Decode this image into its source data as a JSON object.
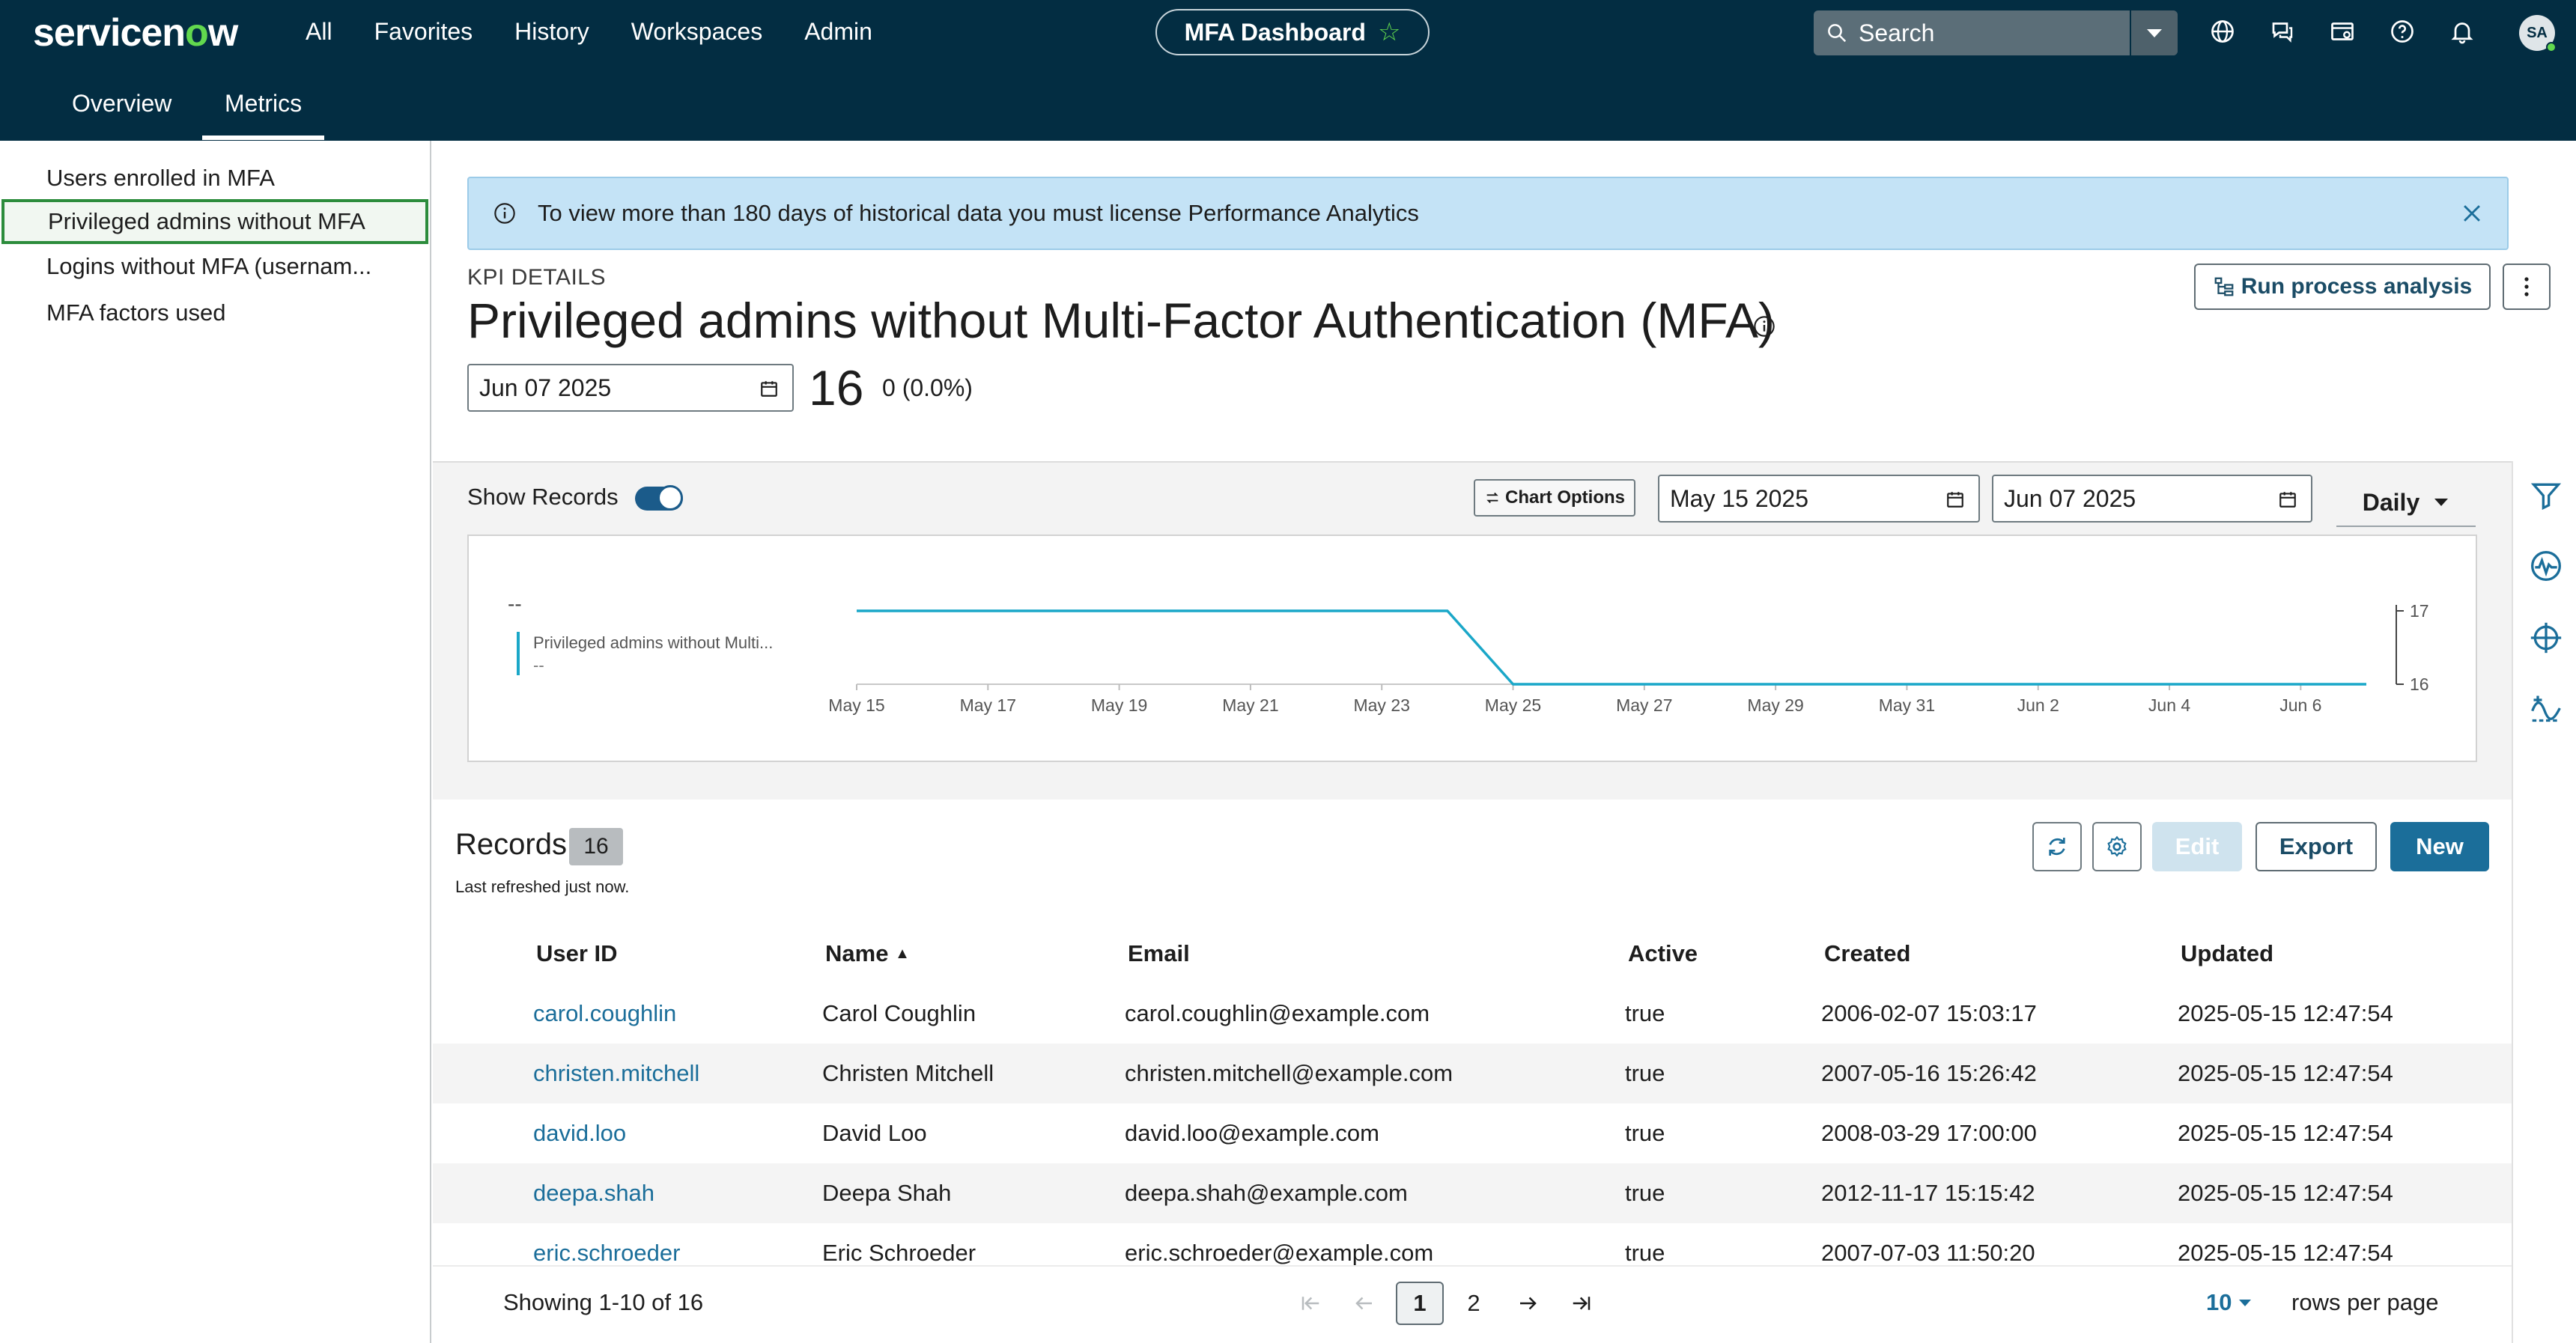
{
  "header": {
    "logo": "servicenow",
    "nav": [
      "All",
      "Favorites",
      "History",
      "Workspaces",
      "Admin"
    ],
    "dashboard_pill": "MFA Dashboard",
    "search_placeholder": "Search",
    "avatar_initials": "SA"
  },
  "subtabs": [
    "Overview",
    "Metrics"
  ],
  "sidebar": {
    "items": [
      {
        "label": "Users enrolled in MFA"
      },
      {
        "label": "Privileged admins without MFA"
      },
      {
        "label": "Logins without MFA (usernam..."
      },
      {
        "label": "MFA factors used"
      }
    ]
  },
  "banner": {
    "text": "To view more than 180 days of historical data you must license Performance Analytics"
  },
  "kpi": {
    "label": "KPI DETAILS",
    "title": "Privileged admins without Multi-Factor Authentication (MFA)",
    "run_button": "Run process analysis",
    "date": "Jun 07 2025",
    "value": "16",
    "change": "0 (0.0%)"
  },
  "chart_controls": {
    "show_records": "Show Records",
    "chart_options": "Chart Options",
    "start_date": "May 15 2025",
    "end_date": "Jun 07 2025",
    "interval": "Daily"
  },
  "chart_data": {
    "type": "line",
    "legend_label": "Privileged admins without Multi...",
    "legend_value": "--",
    "top_value": "--",
    "x_ticks": [
      "May 15",
      "May 17",
      "May 19",
      "May 21",
      "May 23",
      "May 25",
      "May 27",
      "May 29",
      "May 31",
      "Jun 2",
      "Jun 4",
      "Jun 6"
    ],
    "y_ticks": [
      17,
      16
    ],
    "ylim": [
      16,
      17
    ],
    "series": [
      {
        "x": [
          "May 15",
          "May 16",
          "May 17",
          "May 18",
          "May 19",
          "May 20",
          "May 21",
          "May 22",
          "May 23",
          "May 24",
          "May 25",
          "May 26",
          "May 27",
          "May 28",
          "May 29",
          "May 30",
          "May 31",
          "Jun 1",
          "Jun 2",
          "Jun 3",
          "Jun 4",
          "Jun 5",
          "Jun 6",
          "Jun 7"
        ],
        "values": [
          17,
          17,
          17,
          17,
          17,
          17,
          17,
          17,
          17,
          17,
          16,
          16,
          16,
          16,
          16,
          16,
          16,
          16,
          16,
          16,
          16,
          16,
          16,
          16
        ]
      }
    ],
    "color": "#1aa7c8",
    "legend_position": "left",
    "grid": false
  },
  "records": {
    "title": "Records",
    "count": "16",
    "subtitle": "Last refreshed just now.",
    "edit": "Edit",
    "export": "Export",
    "new": "New",
    "columns": [
      "User ID",
      "Name",
      "Email",
      "Active",
      "Created",
      "Updated"
    ],
    "rows": [
      {
        "user_id": "carol.coughlin",
        "name": "Carol Coughlin",
        "email": "carol.coughlin@example.com",
        "active": "true",
        "created": "2006-02-07 15:03:17",
        "updated": "2025-05-15 12:47:54"
      },
      {
        "user_id": "christen.mitchell",
        "name": "Christen Mitchell",
        "email": "christen.mitchell@example.com",
        "active": "true",
        "created": "2007-05-16 15:26:42",
        "updated": "2025-05-15 12:47:54"
      },
      {
        "user_id": "david.loo",
        "name": "David Loo",
        "email": "david.loo@example.com",
        "active": "true",
        "created": "2008-03-29 17:00:00",
        "updated": "2025-05-15 12:47:54"
      },
      {
        "user_id": "deepa.shah",
        "name": "Deepa Shah",
        "email": "deepa.shah@example.com",
        "active": "true",
        "created": "2012-11-17 15:15:42",
        "updated": "2025-05-15 12:47:54"
      },
      {
        "user_id": "eric.schroeder",
        "name": "Eric Schroeder",
        "email": "eric.schroeder@example.com",
        "active": "true",
        "created": "2007-07-03 11:50:20",
        "updated": "2025-05-15 12:47:54"
      }
    ],
    "showing": "Showing 1-10 of 16",
    "pages": [
      "1",
      "2"
    ],
    "rows_per_page_value": "10",
    "rows_per_page_label": "rows per page"
  },
  "colors": {
    "header_bg": "#032d42",
    "accent_green": "#62d84e",
    "link_blue": "#1b6e9a",
    "banner_bg": "#c4e3f6"
  }
}
